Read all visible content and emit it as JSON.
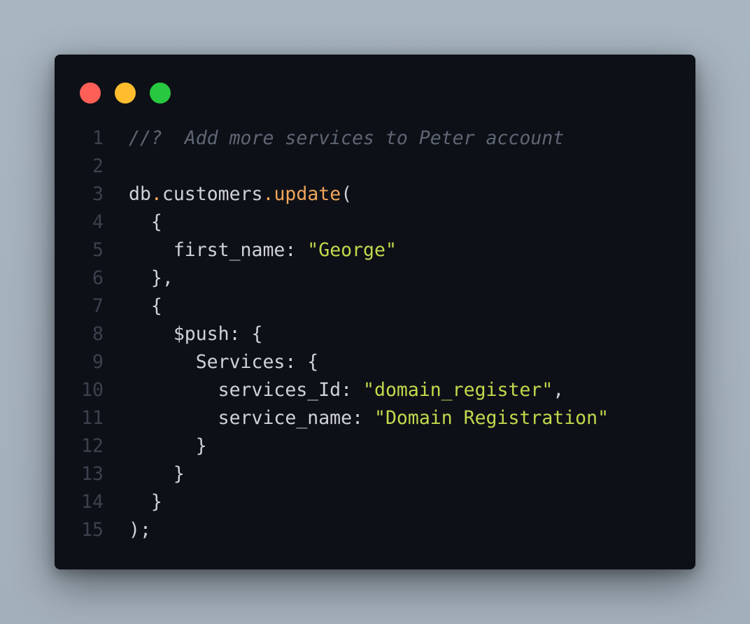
{
  "window": {
    "controls": [
      {
        "name": "close",
        "color": "#ff5f57"
      },
      {
        "name": "minimize",
        "color": "#ffbd2e"
      },
      {
        "name": "maximize",
        "color": "#28c840"
      }
    ]
  },
  "code": {
    "lines": [
      {
        "n": "1",
        "tokens": [
          {
            "t": "//?  Add more services to Peter account",
            "c": "comment"
          }
        ]
      },
      {
        "n": "2",
        "tokens": []
      },
      {
        "n": "3",
        "tokens": [
          {
            "t": "db",
            "c": "key"
          },
          {
            "t": ".",
            "c": "fn"
          },
          {
            "t": "customers",
            "c": "key"
          },
          {
            "t": ".",
            "c": "fn"
          },
          {
            "t": "update",
            "c": "fn"
          },
          {
            "t": "(",
            "c": "punct"
          }
        ]
      },
      {
        "n": "4",
        "tokens": [
          {
            "t": "  {",
            "c": "punct"
          }
        ]
      },
      {
        "n": "5",
        "tokens": [
          {
            "t": "    first_name: ",
            "c": "key"
          },
          {
            "t": "\"George\"",
            "c": "str"
          }
        ]
      },
      {
        "n": "6",
        "tokens": [
          {
            "t": "  },",
            "c": "punct"
          }
        ]
      },
      {
        "n": "7",
        "tokens": [
          {
            "t": "  {",
            "c": "punct"
          }
        ]
      },
      {
        "n": "8",
        "tokens": [
          {
            "t": "    $push: {",
            "c": "key"
          }
        ]
      },
      {
        "n": "9",
        "tokens": [
          {
            "t": "      Services: {",
            "c": "key"
          }
        ]
      },
      {
        "n": "10",
        "tokens": [
          {
            "t": "        services_Id: ",
            "c": "key"
          },
          {
            "t": "\"domain_register\"",
            "c": "str"
          },
          {
            "t": ",",
            "c": "punct"
          }
        ]
      },
      {
        "n": "11",
        "tokens": [
          {
            "t": "        service_name: ",
            "c": "key"
          },
          {
            "t": "\"Domain Registration\"",
            "c": "str"
          }
        ]
      },
      {
        "n": "12",
        "tokens": [
          {
            "t": "      }",
            "c": "punct"
          }
        ]
      },
      {
        "n": "13",
        "tokens": [
          {
            "t": "    }",
            "c": "punct"
          }
        ]
      },
      {
        "n": "14",
        "tokens": [
          {
            "t": "  }",
            "c": "punct"
          }
        ]
      },
      {
        "n": "15",
        "tokens": [
          {
            "t": ");",
            "c": "punct"
          }
        ]
      }
    ]
  }
}
